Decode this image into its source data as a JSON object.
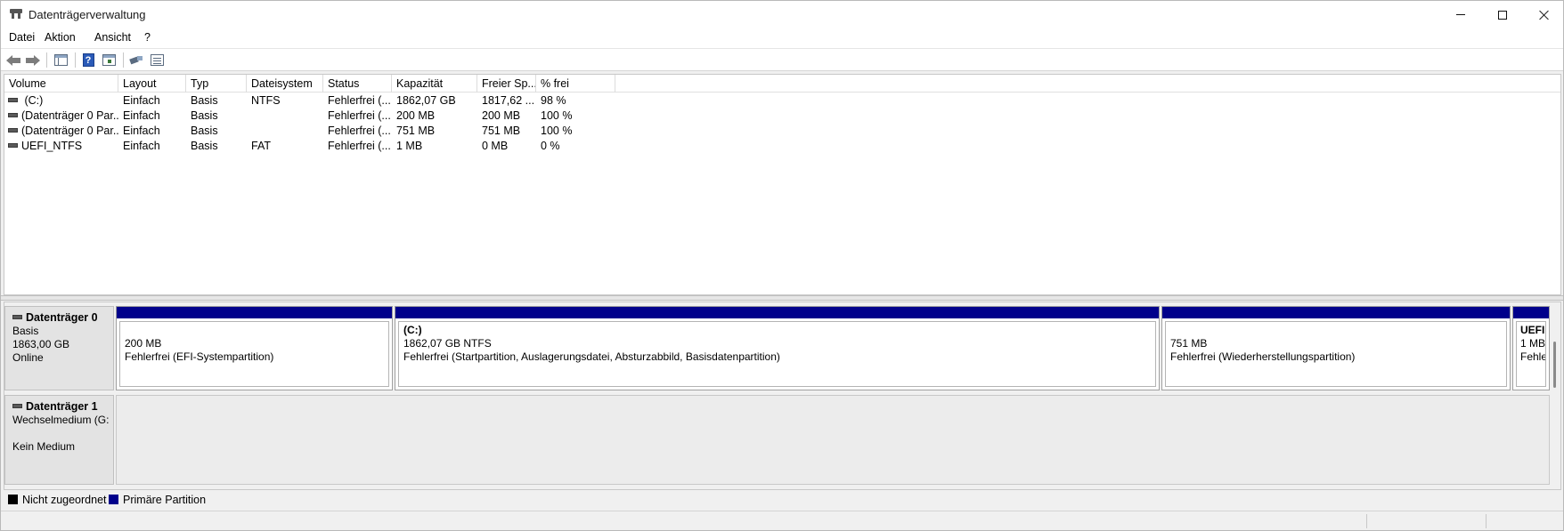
{
  "window": {
    "title": "Datenträgerverwaltung",
    "controls": {
      "minimize": "minimize",
      "maximize": "maximize",
      "close": "close"
    }
  },
  "menu": [
    "Datei",
    "Aktion",
    "Ansicht",
    "?"
  ],
  "toolbar": {
    "icons": [
      "back-arrow-icon",
      "forward-arrow-icon",
      "console-tree-icon",
      "help-icon",
      "action-pane-icon",
      "rescan-disks-icon",
      "properties-icon"
    ]
  },
  "volume_list": {
    "columns": [
      "Volume",
      "Layout",
      "Typ",
      "Dateisystem",
      "Status",
      "Kapazität",
      "Freier Sp...",
      "% frei"
    ],
    "rows": [
      {
        "volume": " (C:)",
        "layout": "Einfach",
        "typ": "Basis",
        "dateisystem": "NTFS",
        "status": "Fehlerfrei (...",
        "kapazitaet": "1862,07 GB",
        "frei": "1817,62 ...",
        "prozent": "98 %"
      },
      {
        "volume": "(Datenträger 0 Par...",
        "layout": "Einfach",
        "typ": "Basis",
        "dateisystem": "",
        "status": "Fehlerfrei (...",
        "kapazitaet": "200 MB",
        "frei": "200 MB",
        "prozent": "100 %"
      },
      {
        "volume": "(Datenträger 0 Par...",
        "layout": "Einfach",
        "typ": "Basis",
        "dateisystem": "",
        "status": "Fehlerfrei (...",
        "kapazitaet": "751 MB",
        "frei": "751 MB",
        "prozent": "100 %"
      },
      {
        "volume": "UEFI_NTFS",
        "layout": "Einfach",
        "typ": "Basis",
        "dateisystem": "FAT",
        "status": "Fehlerfrei (...",
        "kapazitaet": "1 MB",
        "frei": "0 MB",
        "prozent": "0 %"
      }
    ]
  },
  "disks": [
    {
      "name": "Datenträger 0",
      "type": "Basis",
      "size": "1863,00 GB",
      "state": "Online",
      "partitions": [
        {
          "name": "",
          "size": "200 MB",
          "status": "Fehlerfrei (EFI-Systempartition)"
        },
        {
          "name": "(C:)",
          "size": "1862,07 GB NTFS",
          "status": "Fehlerfrei (Startpartition, Auslagerungsdatei, Absturzabbild, Basisdatenpartition)"
        },
        {
          "name": "",
          "size": "751 MB",
          "status": "Fehlerfrei (Wiederherstellungspartition)"
        },
        {
          "name": "UEFI",
          "size": "1 MB",
          "status": "Fehle"
        }
      ]
    },
    {
      "name": "Datenträger 1",
      "type": "Wechselmedium (G:",
      "size": "",
      "state": "Kein Medium"
    }
  ],
  "legend": [
    {
      "label": "Nicht zugeordnet",
      "color": "#000000"
    },
    {
      "label": "Primäre Partition",
      "color": "#00008b"
    }
  ]
}
